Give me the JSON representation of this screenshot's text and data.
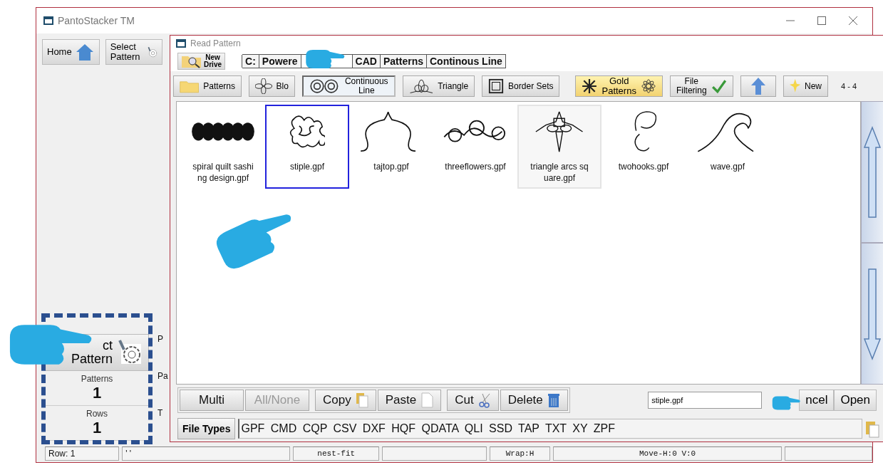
{
  "main_window": {
    "title": "PantoStacker TM",
    "toolbar": [
      {
        "label": "Home"
      },
      {
        "label": "Select Pattern"
      }
    ],
    "panel": {
      "select_button": {
        "lines": [
          "ct",
          "Pattern"
        ]
      },
      "stats": [
        {
          "label": "Patterns",
          "value": "1"
        },
        {
          "label": "Rows",
          "value": "1"
        }
      ],
      "column_2": [
        "P",
        "Pa",
        "T"
      ]
    },
    "status_bar": [
      {
        "text": "Row: 1"
      },
      {
        "text": "' '"
      },
      {
        "text": "nest-fit"
      },
      {
        "text": "Wrap:H"
      },
      {
        "text": "Move-H:0 V:0"
      }
    ]
  },
  "dialog": {
    "title": "Read Pattern",
    "new_drive": [
      "New",
      "Drive"
    ],
    "path": [
      {
        "parts": [
          "C:"
        ]
      },
      {
        "parts": [
          "Powere",
          "CAD"
        ]
      },
      {
        "parts": [
          "Patterns"
        ]
      },
      {
        "parts": [
          "Continous Line"
        ]
      }
    ],
    "categories": [
      {
        "lines": [
          "Patterns"
        ],
        "selected": false
      },
      {
        "lines": [
          "Blo"
        ],
        "selected": false
      },
      {
        "lines": [
          "Continuous",
          "Line"
        ],
        "selected": true
      },
      {
        "lines": [
          "Triangle"
        ],
        "selected": false
      },
      {
        "lines": [
          "Border Sets"
        ],
        "selected": false
      },
      {
        "lines": [
          "Gold",
          "Patterns"
        ],
        "selected": false
      },
      {
        "lines": [
          "File",
          "Filtering"
        ],
        "selected": false
      },
      {
        "lines": [
          "New"
        ],
        "selected": false
      }
    ],
    "page_range": "4 - 4",
    "files": [
      {
        "lines": [
          "spiral quilt sashi",
          "ng design.gpf"
        ],
        "selected": false,
        "highlighted": false
      },
      {
        "lines": [
          "stiple.gpf"
        ],
        "selected": true,
        "highlighted": false
      },
      {
        "lines": [
          "tajtop.gpf"
        ],
        "selected": false,
        "highlighted": false
      },
      {
        "lines": [
          "threeflowers.gpf"
        ],
        "selected": false,
        "highlighted": false
      },
      {
        "lines": [
          "triangle arcs sq",
          "uare.gpf"
        ],
        "selected": false,
        "highlighted": true
      },
      {
        "lines": [
          "twohooks.gpf"
        ],
        "selected": false,
        "highlighted": false
      },
      {
        "lines": [
          "wave.gpf"
        ],
        "selected": false,
        "highlighted": false
      }
    ],
    "actions": [
      {
        "label": "Multi",
        "disabled": false
      },
      {
        "label": "All/None",
        "disabled": true
      },
      {
        "label": "Copy",
        "disabled": false
      },
      {
        "label": "Paste",
        "disabled": false
      },
      {
        "label": "Cut",
        "disabled": false
      },
      {
        "label": "Delete",
        "disabled": false
      }
    ],
    "filename": "stiple.gpf",
    "cancel": "ncel",
    "open": "Open",
    "file_types_button": "File Types",
    "file_types": "GPF CMD CQP CSV DXF HQF QDATA QLI SSD TAP TXT XY ZPF"
  }
}
